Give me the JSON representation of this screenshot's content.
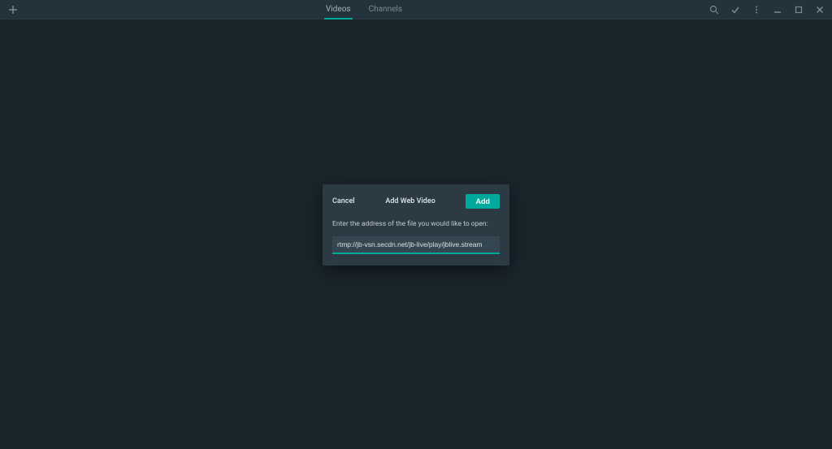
{
  "topbar": {
    "tabs": [
      {
        "label": "Videos",
        "active": true
      },
      {
        "label": "Channels",
        "active": false
      }
    ]
  },
  "dialog": {
    "cancel_label": "Cancel",
    "title": "Add Web Video",
    "add_label": "Add",
    "prompt": "Enter the address of the file you would like to open:",
    "input_value": "rtmp://jb-vsn.secdn.net/jb-live/play/jblive.stream"
  }
}
